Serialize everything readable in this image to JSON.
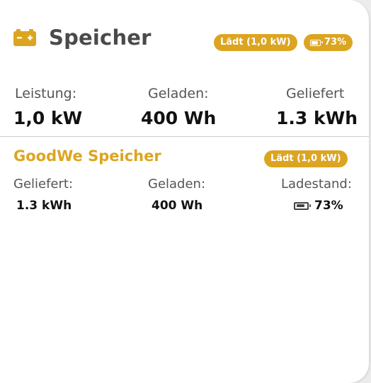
{
  "header": {
    "title": "Speicher",
    "icon": "battery-icon",
    "status_badge": "Lädt (1,0 kW)",
    "soc_badge": "73%"
  },
  "summary": {
    "power_label": "Leistung:",
    "power_value": "1,0 kW",
    "charged_label": "Geladen:",
    "charged_value": "400 Wh",
    "delivered_label": "Geliefert",
    "delivered_value": "1.3 kWh"
  },
  "device": {
    "name": "GoodWe Speicher",
    "status_badge": "Lädt (1,0 kW)",
    "delivered_label": "Geliefert:",
    "delivered_value": "1.3 kWh",
    "charged_label": "Geladen:",
    "charged_value": "400 Wh",
    "soc_label": "Ladestand:",
    "soc_value": "73%"
  },
  "colors": {
    "accent": "#dca521",
    "title": "#4a4a4a",
    "text": "#111111",
    "label": "#555555"
  }
}
